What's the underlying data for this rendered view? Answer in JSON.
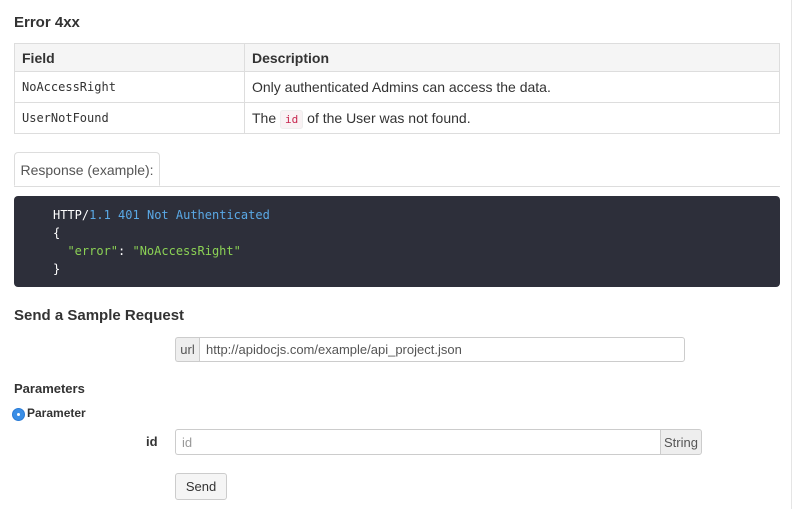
{
  "errors": {
    "title": "Error 4xx",
    "headers": {
      "field": "Field",
      "description": "Description"
    },
    "rows": [
      {
        "field": "NoAccessRight",
        "desc_pre": "Only authenticated Admins can access the data.",
        "code": "",
        "desc_post": ""
      },
      {
        "field": "UserNotFound",
        "desc_pre": "The",
        "code": "id",
        "desc_post": "of the User was not found."
      }
    ]
  },
  "response_tab": {
    "label": "Response (example):"
  },
  "response_code": {
    "proto": "HTTP/",
    "version": "1.1",
    "status": "401",
    "reason": "Not Authenticated",
    "open_brace": "{",
    "key": "\"error\"",
    "colon": ": ",
    "value": "\"NoAccessRight\"",
    "close_brace": "}"
  },
  "sample": {
    "title": "Send a Sample Request",
    "url_addon": "url",
    "url_value": "http://apidocjs.com/example/api_project.json"
  },
  "params": {
    "title": "Parameters",
    "group_label": "Parameter",
    "id_label": "id",
    "id_placeholder": "id",
    "id_type": "String",
    "send_label": "Send"
  },
  "colors": {
    "code_bg": "#2d2f3a",
    "number": "#5aa9e6",
    "string": "#8bd155",
    "radio": "#3a8ee6"
  }
}
